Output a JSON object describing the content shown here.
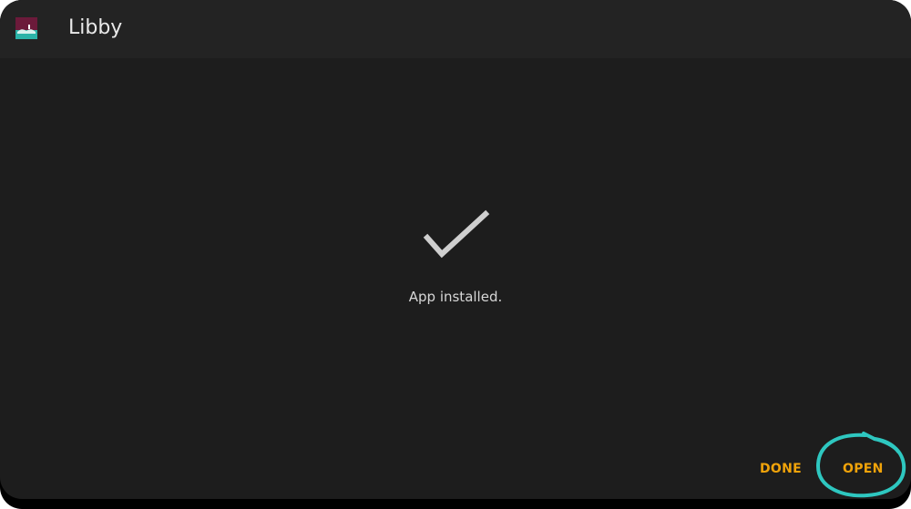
{
  "header": {
    "app_icon": "libby-app-icon",
    "title": "Libby"
  },
  "main": {
    "status_icon": "checkmark-icon",
    "status_text": "App installed."
  },
  "actions": {
    "done_label": "DONE",
    "open_label": "OPEN"
  },
  "annotation": {
    "type": "hand-drawn-circle",
    "target": "open-button",
    "color": "#2ec7c0"
  },
  "colors": {
    "background": "#1d1d1d",
    "header": "#232323",
    "accent": "#f0a30a",
    "text": "#d6d6d6"
  }
}
